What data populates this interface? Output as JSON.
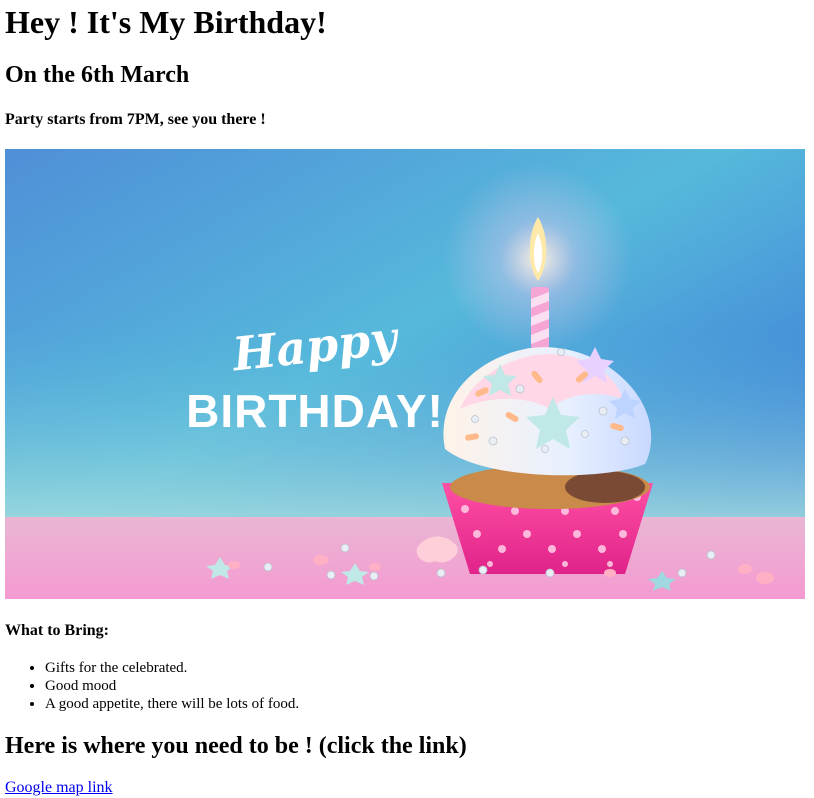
{
  "heading": "Hey ! It's My Birthday!",
  "date": "On the 6th March",
  "party": "Party starts from 7PM, see you there !",
  "banner": {
    "script_text": "Happy",
    "title_text": "BIRTHDAY!",
    "colors": {
      "sky_top": "#3a6bd6",
      "sky_mid": "#56b9db",
      "table": "#f4a6d6"
    }
  },
  "bring": {
    "title": "What to Bring:",
    "items": [
      "Gifts for the celebrated.",
      "Good mood",
      "A good appetite, there will be lots of food."
    ]
  },
  "where": "Here is where you need to be ! (click the link)",
  "map_link": "Google map link"
}
